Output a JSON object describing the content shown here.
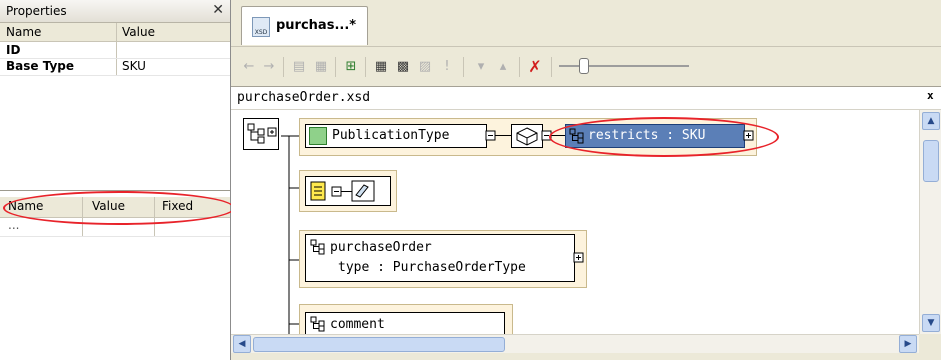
{
  "properties_panel": {
    "title": "Properties",
    "columns": [
      "Name",
      "Value"
    ],
    "rows": [
      {
        "name": "ID",
        "value": ""
      },
      {
        "name": "Base Type",
        "value": "SKU"
      }
    ],
    "facets_columns": [
      "Name",
      "Value",
      "Fixed"
    ],
    "facets_placeholder": "..."
  },
  "editor": {
    "tab_title": "purchas...*",
    "tab_icon_text": "XSD",
    "path": "purchaseOrder.xsd",
    "nodes": {
      "publication_type": "PublicationType",
      "restricts": "restricts : SKU",
      "purchase_order": "purchaseOrder",
      "purchase_order_type": "type : PurchaseOrderType",
      "comment": "comment"
    }
  },
  "colors": {
    "highlight": "#5b7fb7",
    "annotation": "#e8232a",
    "chrome": "#ece9d8"
  }
}
